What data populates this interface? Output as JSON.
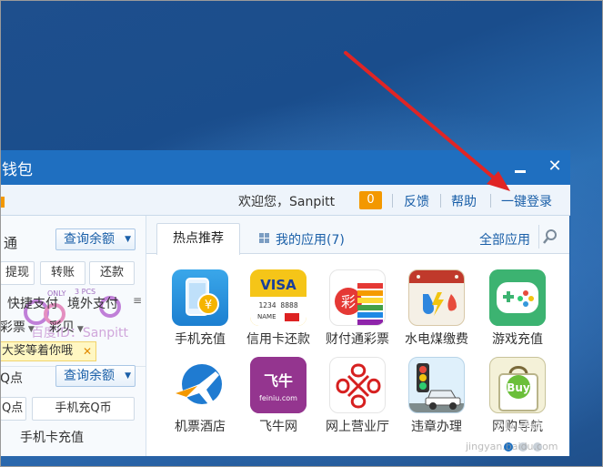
{
  "window": {
    "title_fragment": "钱包"
  },
  "toolbar": {
    "welcome": "欢迎您，Sanpitt",
    "msg_count": "0",
    "feedback": "反馈",
    "help": "帮助",
    "one_click_login": "一键登录"
  },
  "left_panel": {
    "service_fragment": "通",
    "query_balance": "查询余额",
    "withdraw": "提现",
    "transfer": "转账",
    "repay": "还款",
    "quick_pay": "快捷支付",
    "overseas_pay": "境外支付",
    "lottery": "彩票",
    "cowry": "彩贝",
    "promo": "大奖等着你哦",
    "qpoint_fragment": "Q点",
    "query_balance_2": "查询余额",
    "qpoint_btn_fragment": "Q点",
    "mobile_qcoin": "手机充Q币",
    "phone_card": "手机卡充值"
  },
  "right_panel": {
    "tab_hot": "热点推荐",
    "tab_mine": "我的应用(7)",
    "all_apps": "全部应用",
    "apps": [
      {
        "label": "手机充值",
        "icon": "mobile-recharge-icon"
      },
      {
        "label": "信用卡还款",
        "icon": "credit-card-icon"
      },
      {
        "label": "财付通彩票",
        "icon": "lottery-icon"
      },
      {
        "label": "水电煤缴费",
        "icon": "utilities-icon"
      },
      {
        "label": "游戏充值",
        "icon": "gamepad-icon"
      },
      {
        "label": "机票酒店",
        "icon": "plane-icon"
      },
      {
        "label": "飞牛网",
        "icon": "feiniu-icon"
      },
      {
        "label": "网上营业厅",
        "icon": "unicom-icon"
      },
      {
        "label": "违章办理",
        "icon": "traffic-car-icon"
      },
      {
        "label": "网购导航",
        "icon": "buy-bag-icon"
      }
    ],
    "credit_card_visa": "VISA",
    "credit_card_num": "1234 8888",
    "credit_card_name": "NAME",
    "feiniu_logo": "飞牛",
    "feiniu_url": "feiniu.com",
    "buy_text": "Buy"
  },
  "watermark": {
    "text": "百度ID：Sanpitt",
    "logo_top": "ONLY 3 PCS",
    "baidu": "Baidu经验",
    "baidu_sub": "jingyan.baidu.com"
  },
  "colors": {
    "titlebar": "#1f6fc0",
    "accent_orange": "#f39800",
    "link_blue": "#1a5fa8",
    "arrow_red": "#e02525"
  }
}
